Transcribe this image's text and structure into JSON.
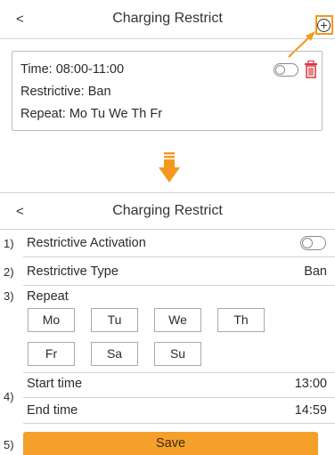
{
  "top_screen": {
    "header": {
      "back_label": "<",
      "title": "Charging Restrict"
    },
    "rule": {
      "time": "Time: 08:00-11:00",
      "restrictive": "Restrictive: Ban",
      "repeat": "Repeat: Mo Tu We Th Fr",
      "enabled": false
    }
  },
  "bottom_screen": {
    "header": {
      "back_label": "<",
      "title": "Charging Restrict"
    },
    "rows": {
      "activation": {
        "num": "1)",
        "label": "Restrictive Activation",
        "enabled": false
      },
      "type": {
        "num": "2)",
        "label": "Restrictive Type",
        "value": "Ban"
      },
      "repeat": {
        "num": "3)",
        "label": "Repeat"
      },
      "time": {
        "num": "4)",
        "start_label": "Start time",
        "start_value": "13:00",
        "end_label": "End time",
        "end_value": "14:59"
      },
      "save": {
        "num": "5)",
        "label": "Save"
      }
    },
    "days": [
      "Mo",
      "Tu",
      "We",
      "Th",
      "Fr",
      "Sa",
      "Su"
    ]
  },
  "colors": {
    "accent": "#f39a1e",
    "delete": "#d9363e",
    "divider": "#d2d2d2"
  },
  "icons": {
    "add": "plus-circle-icon",
    "delete": "trash-icon",
    "pointer": "arrow-icon",
    "transition": "arrow-down-icon"
  }
}
